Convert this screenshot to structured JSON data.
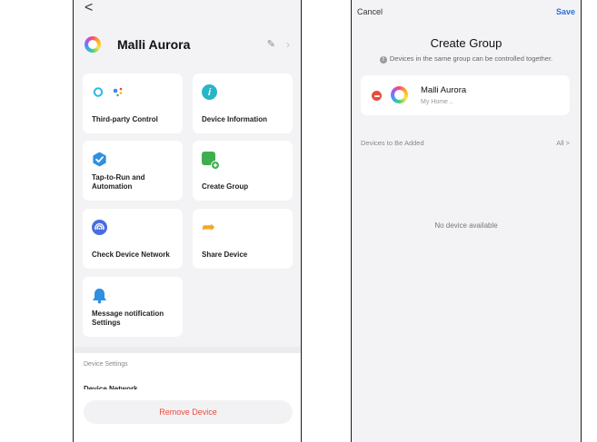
{
  "left_screen": {
    "back_glyph": "<",
    "device_name": "Malli Aurora",
    "edit_glyph": "✎",
    "chevron_glyph": "›",
    "cards": [
      {
        "label": "Third-party Control",
        "icon": "alexa-google-icon"
      },
      {
        "label": "Device Information",
        "icon": "info-icon",
        "glyph": "i",
        "color": "#26b6c8"
      },
      {
        "label": "Tap-to-Run and Automation",
        "icon": "automation-check-icon",
        "glyph": "✓",
        "color": "#2f8fe0"
      },
      {
        "label": "Create Group",
        "icon": "create-group-icon",
        "glyph": "+",
        "color": "#3fae4f"
      },
      {
        "label": "Check Device Network",
        "icon": "network-icon",
        "color": "#4a6ce0"
      },
      {
        "label": "Share Device",
        "icon": "share-arrow-icon",
        "glyph": "➦",
        "color": "#f5a623"
      },
      {
        "label": "Message notification Settings",
        "icon": "bell-icon",
        "color": "#2f8fe0"
      }
    ],
    "section_label": "Device Settings",
    "section_item_partial": "Device Network",
    "remove_label": "Remove Device"
  },
  "right_screen": {
    "cancel_label": "Cancel",
    "save_label": "Save",
    "title": "Create Group",
    "subtitle": "Devices in the same group can be controlled together.",
    "member": {
      "name": "Malli Aurora",
      "home": "My Home .."
    },
    "devices_to_add_label": "Devices to Be Added",
    "all_label": "All >",
    "empty_text": "No device available"
  },
  "colors": {
    "accent": "#2f6fd6",
    "danger": "#e84c3d",
    "background": "#f3f3f5"
  }
}
